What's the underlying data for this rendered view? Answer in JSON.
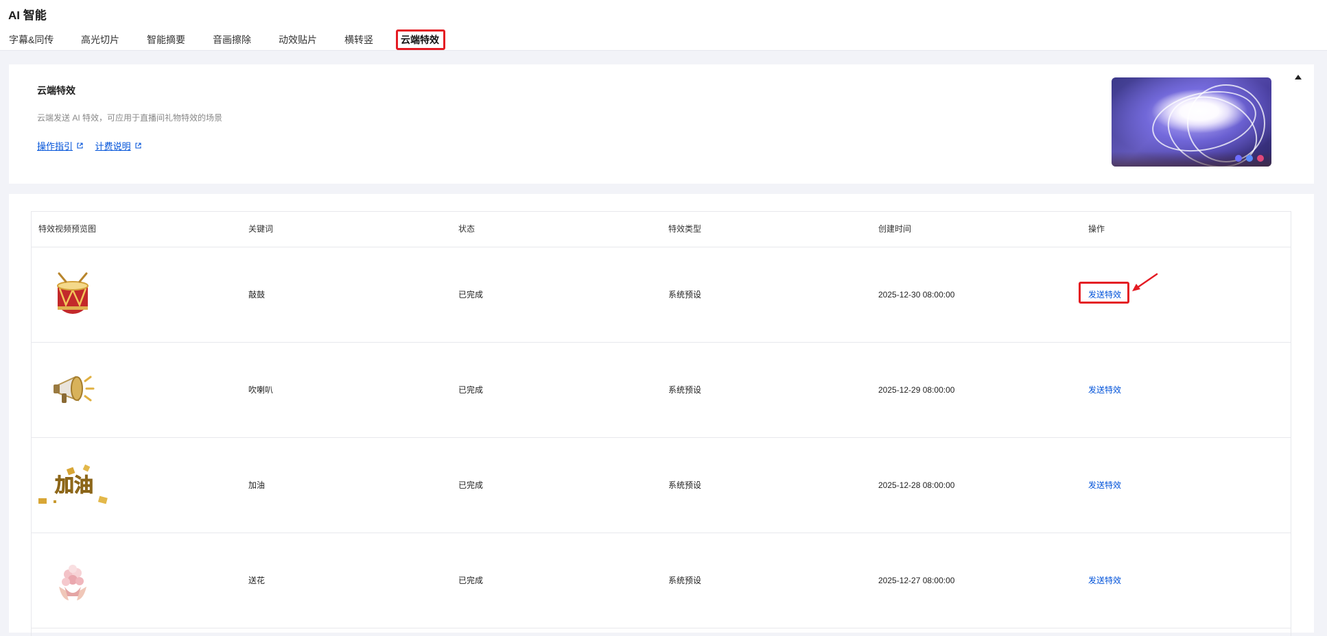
{
  "page": {
    "title": "AI 智能"
  },
  "tabs": [
    {
      "label": "字幕&同传",
      "active": false
    },
    {
      "label": "高光切片",
      "active": false
    },
    {
      "label": "智能摘要",
      "active": false
    },
    {
      "label": "音画擦除",
      "active": false
    },
    {
      "label": "动效贴片",
      "active": false
    },
    {
      "label": "横转竖",
      "active": false
    },
    {
      "label": "云端特效",
      "active": true
    }
  ],
  "intro": {
    "title": "云端特效",
    "description": "云端发送 AI 特效，可应用于直播间礼物特效的场景",
    "links": [
      {
        "label": "操作指引",
        "icon": "external-link-icon"
      },
      {
        "label": "计费说明",
        "icon": "external-link-icon"
      }
    ]
  },
  "table": {
    "columns": [
      "特效视频预览图",
      "关键词",
      "状态",
      "特效类型",
      "创建时间",
      "操作"
    ],
    "rows": [
      {
        "thumb": "drum-icon",
        "keyword": "敲鼓",
        "status": "已完成",
        "type": "系统预设",
        "created": "2025-12-30 08:00:00",
        "action": "发送特效"
      },
      {
        "thumb": "megaphone-icon",
        "keyword": "吹喇叭",
        "status": "已完成",
        "type": "系统预设",
        "created": "2025-12-29 08:00:00",
        "action": "发送特效"
      },
      {
        "thumb": "jiayou-text-icon",
        "thumb_text": "加油",
        "keyword": "加油",
        "status": "已完成",
        "type": "系统预设",
        "created": "2025-12-28 08:00:00",
        "action": "发送特效"
      },
      {
        "thumb": "flower-bouquet-icon",
        "keyword": "送花",
        "status": "已完成",
        "type": "系统预设",
        "created": "2025-12-27 08:00:00",
        "action": "发送特效"
      }
    ]
  },
  "colors": {
    "accent": "#0052d9",
    "highlight": "#e41b23",
    "background": "#f2f3f8"
  }
}
